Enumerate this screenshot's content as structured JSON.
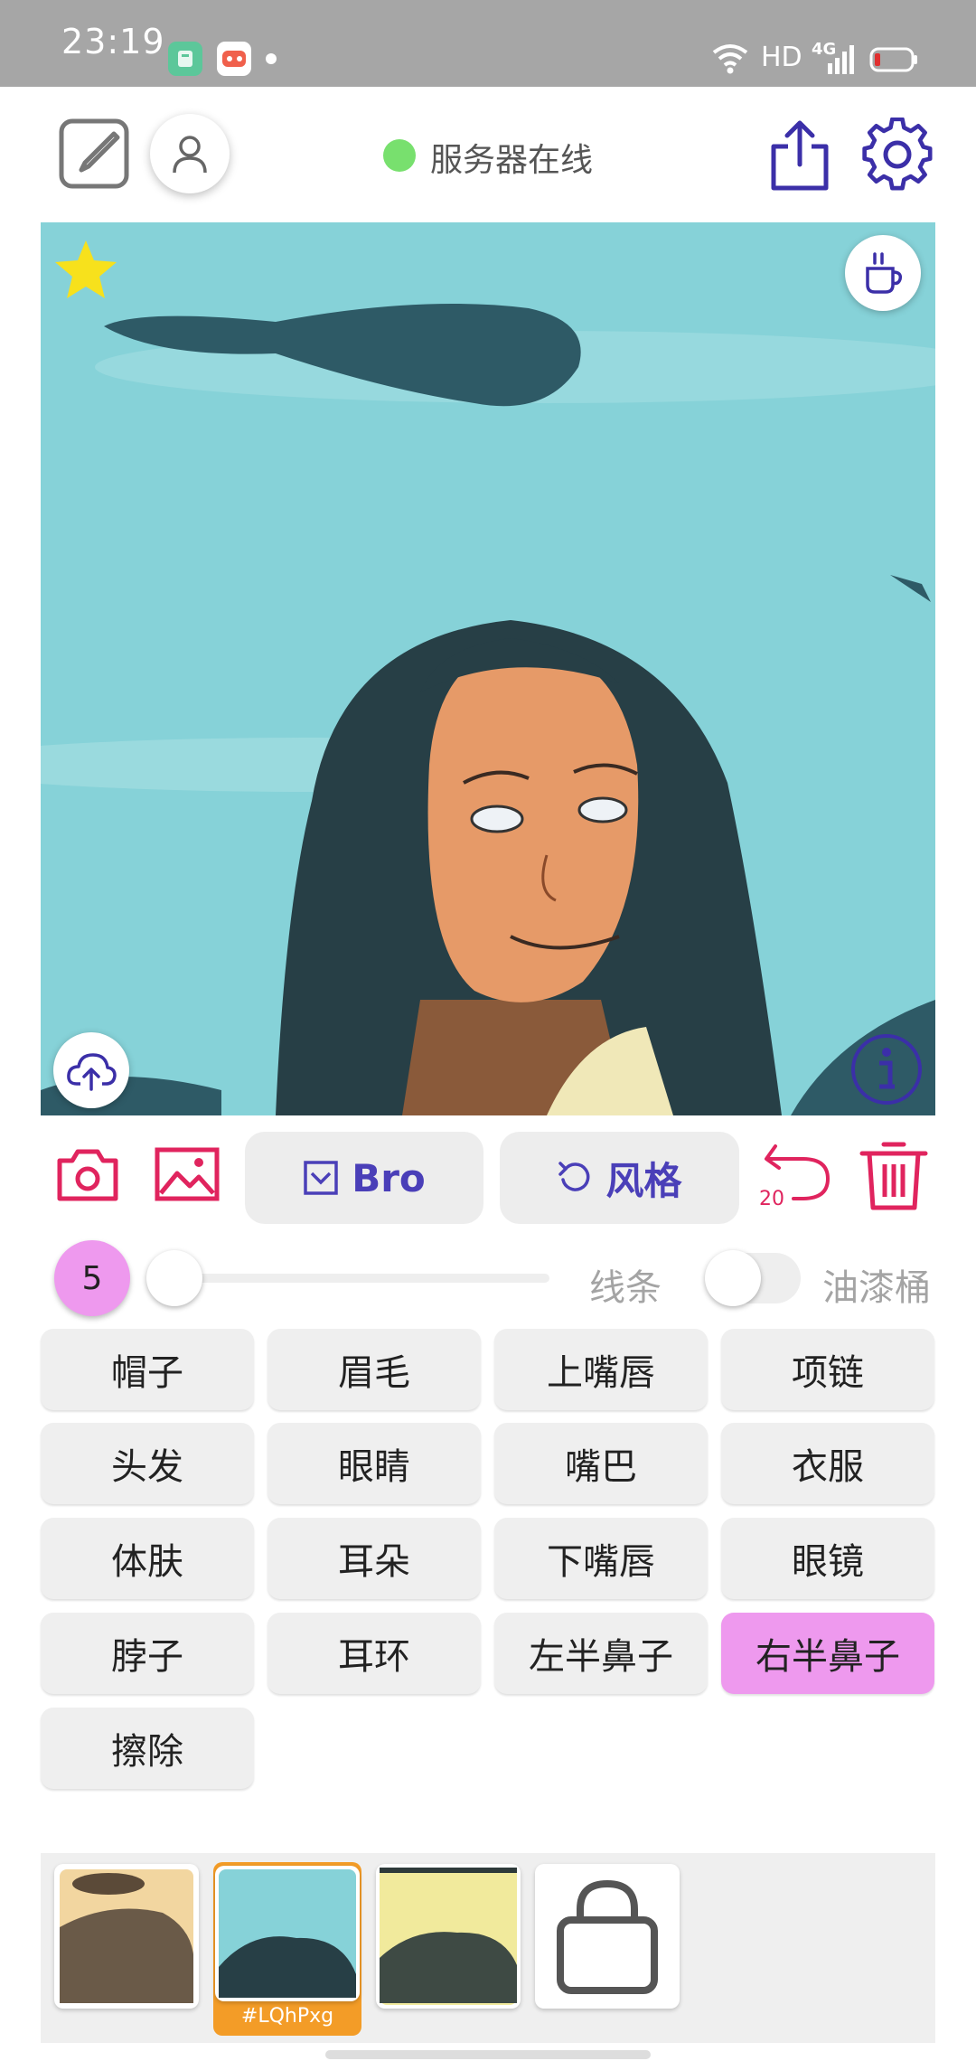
{
  "status_bar": {
    "time": "23:19",
    "hd_label": "HD",
    "network": "4G",
    "icons": [
      "app-icon-green",
      "app-icon-game",
      "wifi-icon",
      "signal-icon",
      "battery-icon"
    ]
  },
  "header": {
    "server_status": "服务器在线",
    "status_color": "#78e06e",
    "icons": [
      "edit-icon",
      "user-icon",
      "share-icon",
      "gear-icon"
    ]
  },
  "canvas": {
    "icons": [
      "star-icon",
      "coffee-icon",
      "cloud-upload-icon",
      "info-icon"
    ]
  },
  "toolbar": {
    "bro_label": "Bro",
    "style_label": "风格",
    "undo_count": "20",
    "icons": [
      "camera-icon",
      "image-icon",
      "checkbox-icon",
      "refresh-icon",
      "undo-icon",
      "trash-icon"
    ]
  },
  "brush": {
    "size": "5",
    "slider_value": 0,
    "line_label": "线条",
    "bucket_label": "油漆桶",
    "bucket_on": false
  },
  "parts": {
    "items": [
      "帽子",
      "眉毛",
      "上嘴唇",
      "项链",
      "头发",
      "眼睛",
      "嘴巴",
      "衣服",
      "体肤",
      "耳朵",
      "下嘴唇",
      "眼镜",
      "脖子",
      "耳环",
      "左半鼻子",
      "右半鼻子",
      "擦除"
    ],
    "selected": "右半鼻子",
    "selected_color": "#ee99ee"
  },
  "gallery": {
    "selected_tag": "#LQhPxg",
    "selected_color": "#f39c27",
    "icons": [
      "bag-icon"
    ]
  },
  "colors": {
    "accent_red": "#e0245e",
    "accent_purple": "#4a3fb8",
    "sky": "#86d2d8"
  }
}
